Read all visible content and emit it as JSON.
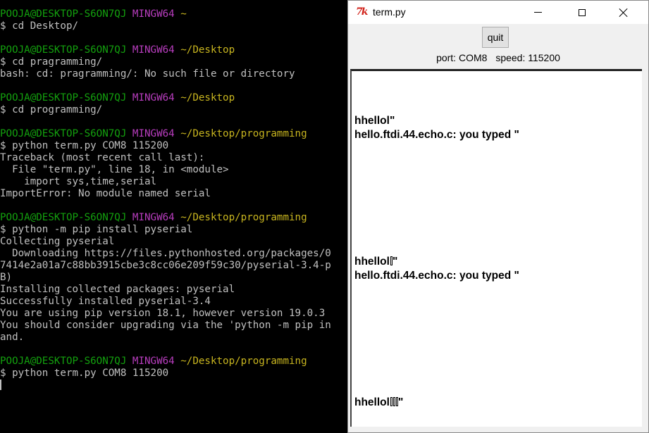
{
  "terminal": {
    "lines": [
      {
        "segments": [
          {
            "t": "POOJA@DESKTOP-S6ON7QJ",
            "c": "user"
          },
          {
            "t": " "
          },
          {
            "t": "MINGW64",
            "c": "sys"
          },
          {
            "t": " "
          },
          {
            "t": "~",
            "c": "path"
          }
        ]
      },
      {
        "segments": [
          {
            "t": "$ cd Desktop/"
          }
        ]
      },
      {
        "segments": []
      },
      {
        "segments": [
          {
            "t": "POOJA@DESKTOP-S6ON7QJ",
            "c": "user"
          },
          {
            "t": " "
          },
          {
            "t": "MINGW64",
            "c": "sys"
          },
          {
            "t": " "
          },
          {
            "t": "~/Desktop",
            "c": "path"
          }
        ]
      },
      {
        "segments": [
          {
            "t": "$ cd pragramming/"
          }
        ]
      },
      {
        "segments": [
          {
            "t": "bash: cd: pragramming/: No such file or directory"
          }
        ]
      },
      {
        "segments": []
      },
      {
        "segments": [
          {
            "t": "POOJA@DESKTOP-S6ON7QJ",
            "c": "user"
          },
          {
            "t": " "
          },
          {
            "t": "MINGW64",
            "c": "sys"
          },
          {
            "t": " "
          },
          {
            "t": "~/Desktop",
            "c": "path"
          }
        ]
      },
      {
        "segments": [
          {
            "t": "$ cd programming/"
          }
        ]
      },
      {
        "segments": []
      },
      {
        "segments": [
          {
            "t": "POOJA@DESKTOP-S6ON7QJ",
            "c": "user"
          },
          {
            "t": " "
          },
          {
            "t": "MINGW64",
            "c": "sys"
          },
          {
            "t": " "
          },
          {
            "t": "~/Desktop/programming",
            "c": "path"
          }
        ]
      },
      {
        "segments": [
          {
            "t": "$ python term.py COM8 115200"
          }
        ]
      },
      {
        "segments": [
          {
            "t": "Traceback (most recent call last):"
          }
        ]
      },
      {
        "segments": [
          {
            "t": "  File \"term.py\", line 18, in <module>"
          }
        ]
      },
      {
        "segments": [
          {
            "t": "    import sys,time,serial"
          }
        ]
      },
      {
        "segments": [
          {
            "t": "ImportError: No module named serial"
          }
        ]
      },
      {
        "segments": []
      },
      {
        "segments": [
          {
            "t": "POOJA@DESKTOP-S6ON7QJ",
            "c": "user"
          },
          {
            "t": " "
          },
          {
            "t": "MINGW64",
            "c": "sys"
          },
          {
            "t": " "
          },
          {
            "t": "~/Desktop/programming",
            "c": "path"
          }
        ]
      },
      {
        "segments": [
          {
            "t": "$ python -m pip install pyserial"
          }
        ]
      },
      {
        "segments": [
          {
            "t": "Collecting pyserial"
          }
        ]
      },
      {
        "segments": [
          {
            "t": "  Downloading https://files.pythonhosted.org/packages/0"
          }
        ]
      },
      {
        "segments": [
          {
            "t": "7414e2a01a7c88bb3915cbe3c8cc06e209f59c30/pyserial-3.4-p"
          }
        ]
      },
      {
        "segments": [
          {
            "t": "B)"
          }
        ]
      },
      {
        "segments": [
          {
            "t": "Installing collected packages: pyserial"
          }
        ]
      },
      {
        "segments": [
          {
            "t": "Successfully installed pyserial-3.4"
          }
        ]
      },
      {
        "segments": [
          {
            "t": "You are using pip version 18.1, however version 19.0.3"
          }
        ]
      },
      {
        "segments": [
          {
            "t": "You should consider upgrading via the 'python -m pip in"
          }
        ]
      },
      {
        "segments": [
          {
            "t": "and."
          }
        ]
      },
      {
        "segments": []
      },
      {
        "segments": [
          {
            "t": "POOJA@DESKTOP-S6ON7QJ",
            "c": "user"
          },
          {
            "t": " "
          },
          {
            "t": "MINGW64",
            "c": "sys"
          },
          {
            "t": " "
          },
          {
            "t": "~/Desktop/programming",
            "c": "path"
          }
        ]
      },
      {
        "segments": [
          {
            "t": "$ python term.py COM8 115200"
          }
        ]
      }
    ]
  },
  "window": {
    "title": "term.py",
    "app_icon": "tk-feather-icon",
    "quit_label": "quit",
    "port_text": "port: COM8",
    "speed_text": "speed: 115200"
  },
  "output": [
    {
      "text": "hhellol\"",
      "glyphs": 0
    },
    {
      "text": "hello.ftdi.44.echo.c: you typed \"",
      "glyphs": 0
    },
    {
      "text": "hhellol",
      "glyphs": 1,
      "suffix": "\""
    },
    {
      "text": "hello.ftdi.44.echo.c: you typed \"",
      "glyphs": 0
    },
    {
      "text": "hhellol",
      "glyphs": 3,
      "suffix": "\""
    }
  ],
  "colors": {
    "terminal_user": "#13a10e",
    "terminal_system": "#b83dbe",
    "terminal_path": "#c8b51f",
    "terminal_text": "#c0c0c0"
  }
}
